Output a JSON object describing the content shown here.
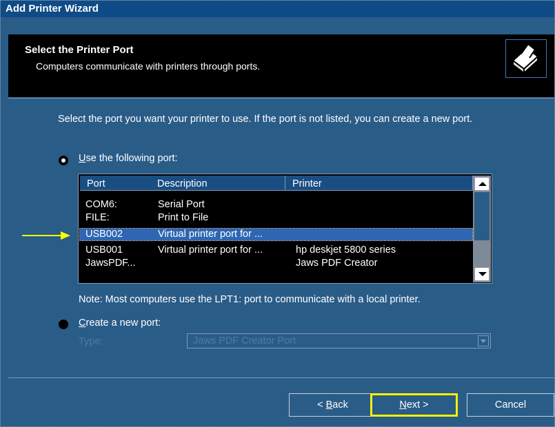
{
  "window": {
    "title": "Add Printer Wizard"
  },
  "header": {
    "title": "Select the Printer Port",
    "subtitle": "Computers communicate with printers through ports."
  },
  "intro": "Select the port you want your printer to use.  If the port is not listed, you can create a new port.",
  "use_port": {
    "label_prefix": "U",
    "label_rest": "se the following port:",
    "selected": true
  },
  "ports_table": {
    "columns": [
      "Port",
      "Description",
      "Printer"
    ],
    "rows": [
      {
        "port": "COM6:",
        "description": "Serial Port",
        "printer": ""
      },
      {
        "port": "FILE:",
        "description": "Print to File",
        "printer": ""
      },
      {
        "port": "USB002",
        "description": "Virtual printer port for ...",
        "printer": "",
        "selected": true
      },
      {
        "port": "USB001",
        "description": "Virtual printer port for ...",
        "printer": "hp deskjet 5800 series"
      },
      {
        "port": "JawsPDF...",
        "description": "",
        "printer": "Jaws PDF Creator"
      }
    ]
  },
  "note": "Note: Most computers use the LPT1: port to communicate with a local printer.",
  "create_port": {
    "label_prefix": "C",
    "label_rest": "reate a new port:",
    "selected": false
  },
  "type": {
    "label": "Type:",
    "value": "Jaws PDF Creator Port"
  },
  "buttons": {
    "back": {
      "prefix": "< ",
      "key": "B",
      "rest": "ack"
    },
    "next": {
      "key": "N",
      "rest": "ext >"
    },
    "cancel": "Cancel"
  },
  "colors": {
    "highlight_arrow": "#FFFF00",
    "next_outline": "#F7F200",
    "selection": "#2E66B3"
  }
}
